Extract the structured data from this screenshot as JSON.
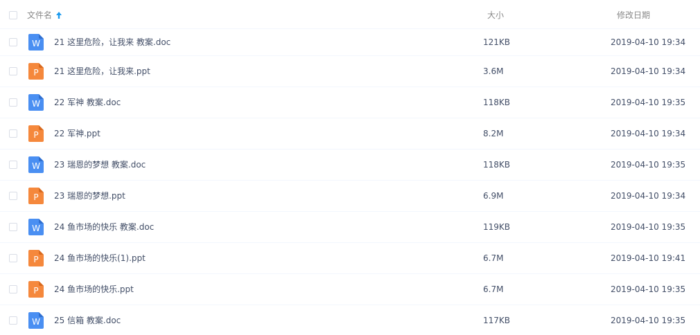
{
  "header": {
    "name_label": "文件名",
    "size_label": "大小",
    "date_label": "修改日期",
    "sort_icon": "arrow-up-icon",
    "sort_color": "#1b9aee"
  },
  "colors": {
    "word_icon": "#4a8ff2",
    "ppt_icon": "#f5883c"
  },
  "files": [
    {
      "type": "word",
      "icon_letter": "W",
      "name": "21 这里危险，让我来 教案.doc",
      "size": "121KB",
      "date": "2019-04-10 19:34"
    },
    {
      "type": "ppt",
      "icon_letter": "P",
      "name": "21 这里危险，让我来.ppt",
      "size": "3.6M",
      "date": "2019-04-10 19:34"
    },
    {
      "type": "word",
      "icon_letter": "W",
      "name": "22 军神 教案.doc",
      "size": "118KB",
      "date": "2019-04-10 19:35"
    },
    {
      "type": "ppt",
      "icon_letter": "P",
      "name": "22 军神.ppt",
      "size": "8.2M",
      "date": "2019-04-10 19:34"
    },
    {
      "type": "word",
      "icon_letter": "W",
      "name": "23 瑞恩的梦想 教案.doc",
      "size": "118KB",
      "date": "2019-04-10 19:35"
    },
    {
      "type": "ppt",
      "icon_letter": "P",
      "name": "23 瑞恩的梦想.ppt",
      "size": "6.9M",
      "date": "2019-04-10 19:34"
    },
    {
      "type": "word",
      "icon_letter": "W",
      "name": "24 鱼市场的快乐 教案.doc",
      "size": "119KB",
      "date": "2019-04-10 19:35"
    },
    {
      "type": "ppt",
      "icon_letter": "P",
      "name": "24 鱼市场的快乐(1).ppt",
      "size": "6.7M",
      "date": "2019-04-10 19:41"
    },
    {
      "type": "ppt",
      "icon_letter": "P",
      "name": "24 鱼市场的快乐.ppt",
      "size": "6.7M",
      "date": "2019-04-10 19:35"
    },
    {
      "type": "word",
      "icon_letter": "W",
      "name": "25 信箱 教案.doc",
      "size": "117KB",
      "date": "2019-04-10 19:35"
    }
  ]
}
